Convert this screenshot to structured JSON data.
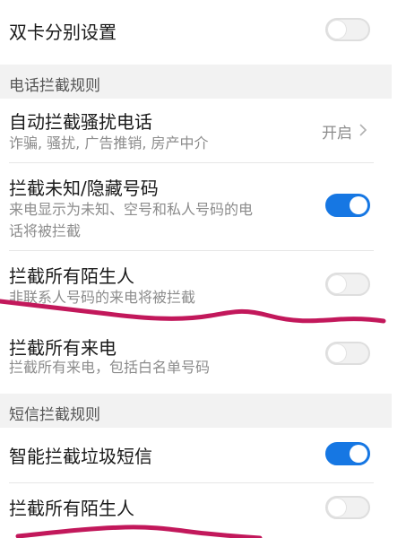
{
  "rows": {
    "dual_sim": {
      "title": "双卡分别设置",
      "enabled": false
    },
    "auto_block": {
      "title": "自动拦截骚扰电话",
      "subtitle": "诈骗, 骚扰, 广告推销, 房产中介",
      "value": "开启"
    },
    "unknown_hidden": {
      "title": "拦截未知/隐藏号码",
      "subtitle_line1": "来电显示为未知、空号和私人号码的电",
      "subtitle_line2": "话将被拦截",
      "enabled": true
    },
    "all_strangers_call": {
      "title": "拦截所有陌生人",
      "subtitle": "非联系人号码的来电将被拦截",
      "enabled": false
    },
    "all_calls": {
      "title": "拦截所有来电",
      "subtitle": "拦截所有来电，包括白名单号码",
      "enabled": false
    },
    "smart_sms": {
      "title": "智能拦截垃圾短信",
      "enabled": true
    },
    "all_strangers_sms": {
      "title": "拦截所有陌生人",
      "enabled": false
    }
  },
  "sections": {
    "call_rules": "电话拦截规则",
    "sms_rules": "短信拦截规则"
  },
  "colors": {
    "toggle_on": "#1677e3",
    "toggle_off": "#f1f1f1",
    "scribble": "#c2185b"
  },
  "icons": {
    "chevron": "chevron-right-icon"
  }
}
